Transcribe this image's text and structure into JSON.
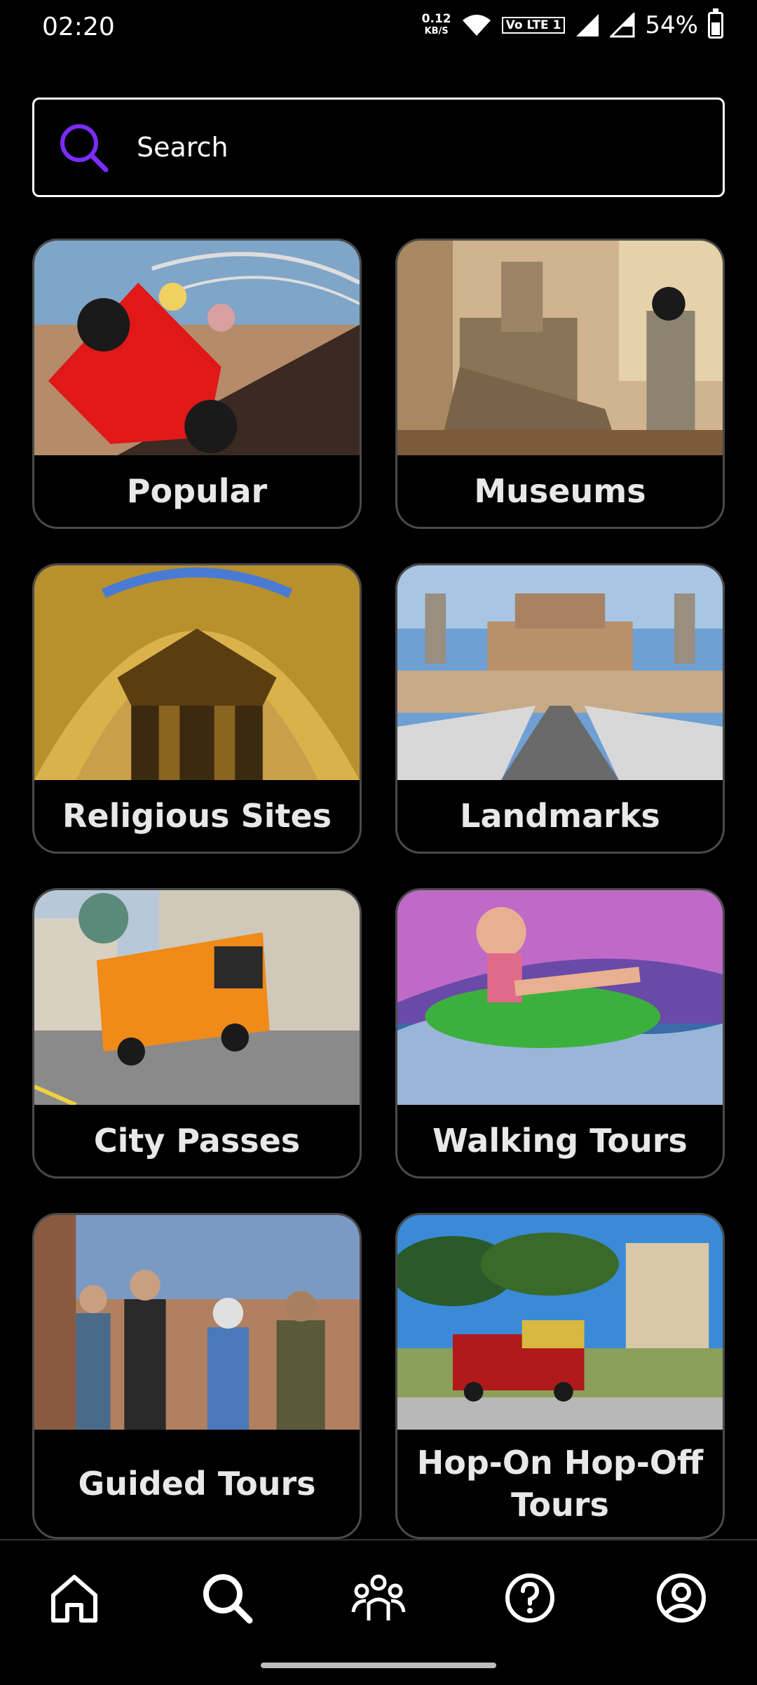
{
  "status_bar": {
    "time": "02:20",
    "network_speed_value": "0.12",
    "network_speed_unit": "KB/S",
    "volte": "Vo LTE 1",
    "battery_percent": "54%"
  },
  "search": {
    "placeholder": "Search",
    "accent_color": "#7b2cff"
  },
  "categories": [
    {
      "label": "Popular"
    },
    {
      "label": "Museums"
    },
    {
      "label": "Religious Sites"
    },
    {
      "label": "Landmarks"
    },
    {
      "label": "City Passes"
    },
    {
      "label": "Walking Tours"
    },
    {
      "label": "Guided Tours"
    },
    {
      "label": "Hop-On Hop-Off Tours"
    }
  ],
  "bottom_nav": [
    {
      "icon": "home-icon"
    },
    {
      "icon": "search-icon"
    },
    {
      "icon": "community-icon"
    },
    {
      "icon": "help-icon"
    },
    {
      "icon": "profile-icon"
    }
  ]
}
